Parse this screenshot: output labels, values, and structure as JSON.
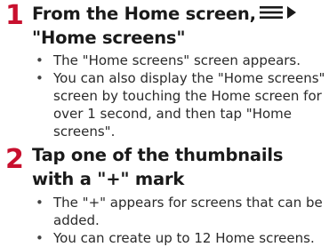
{
  "steps": [
    {
      "number": "1",
      "title_prefix": "From the Home screen,",
      "menu_icon": "menu-icon",
      "arrow_icon": "right-triangle-icon",
      "title_suffix": "\"Home screens\"",
      "bullets": [
        "The \"Home screens\" screen appears.",
        "You can also display the \"Home screens\" screen by touching the Home screen for over 1 second, and then tap \"Home screens\"."
      ]
    },
    {
      "number": "2",
      "title": "Tap one of the thumbnails with a \"+\" mark",
      "bullets": [
        "The \"+\" appears for screens that can be added.",
        "You can create up to 12 Home screens."
      ]
    }
  ],
  "colors": {
    "step_number": "#c8102e",
    "text": "#222222"
  }
}
